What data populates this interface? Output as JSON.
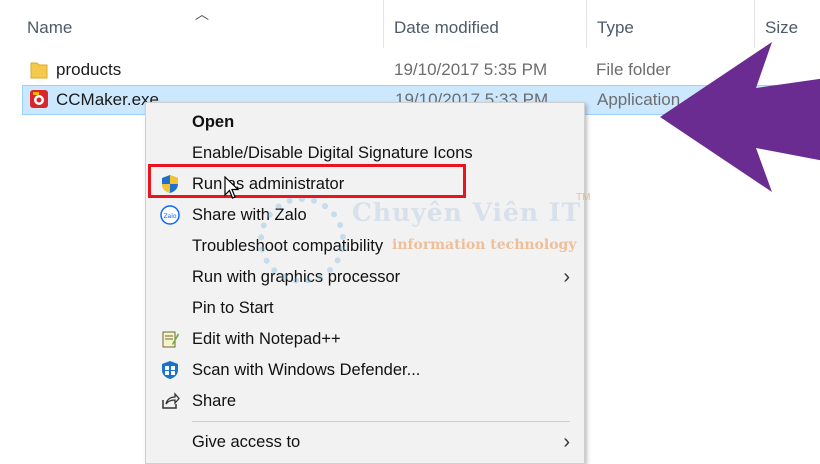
{
  "columns": {
    "name": "Name",
    "date_modified": "Date modified",
    "type": "Type",
    "size": "Size"
  },
  "files": [
    {
      "name": "products",
      "date": "19/10/2017 5:35 PM",
      "type": "File folder",
      "icon": "folder-icon"
    },
    {
      "name": "CCMaker.exe",
      "date": "19/10/2017 5:33 PM",
      "type": "Application",
      "icon": "app-icon"
    }
  ],
  "context_menu": {
    "open": "Open",
    "signature_icons": "Enable/Disable Digital Signature Icons",
    "run_as_admin": "Run as administrator",
    "share_zalo": "Share with Zalo",
    "troubleshoot": "Troubleshoot compatibility",
    "run_graphics": "Run with graphics processor",
    "pin_start": "Pin to Start",
    "edit_notepad": "Edit with Notepad++",
    "scan_defender": "Scan with Windows Defender...",
    "share": "Share",
    "give_access": "Give access to"
  },
  "watermark": {
    "title": "Chuyên Viên IT",
    "tm": "TM",
    "subtitle": "information technology"
  },
  "colors": {
    "selection": "#cce8ff",
    "highlight_box": "#e8141e",
    "arrow": "#6a2c91",
    "menu_bg": "#f2f2f2"
  }
}
